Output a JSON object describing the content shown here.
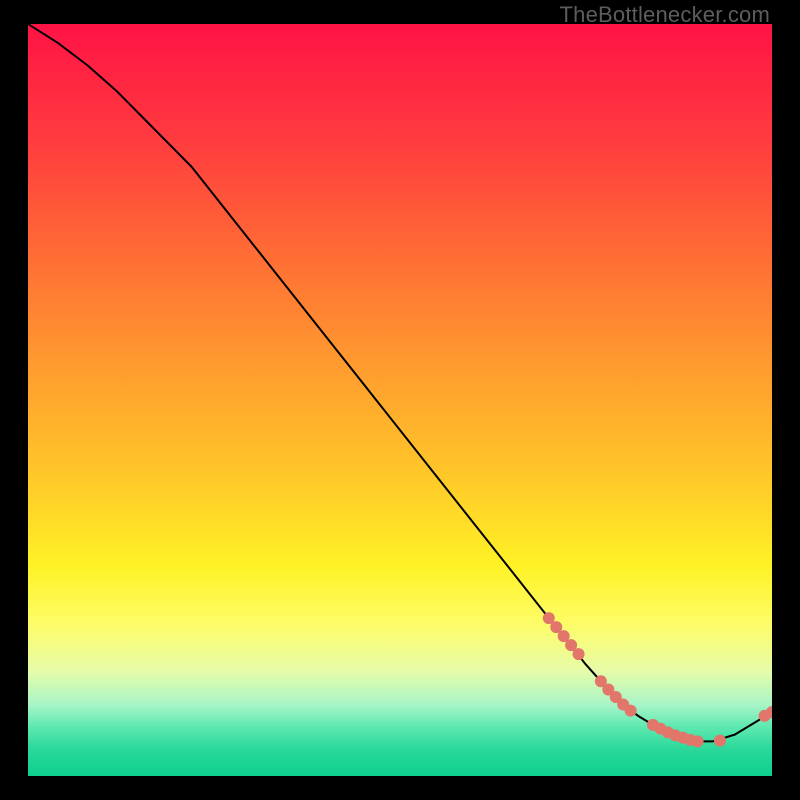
{
  "watermark": "TheBottlenecker.com",
  "gradient": {
    "stops": [
      {
        "offset": 0.0,
        "color": "#ff1345"
      },
      {
        "offset": 0.15,
        "color": "#ff3a3f"
      },
      {
        "offset": 0.3,
        "color": "#ff6a35"
      },
      {
        "offset": 0.45,
        "color": "#ff9a2f"
      },
      {
        "offset": 0.6,
        "color": "#ffc729"
      },
      {
        "offset": 0.72,
        "color": "#fff225"
      },
      {
        "offset": 0.8,
        "color": "#fdfd6a"
      },
      {
        "offset": 0.86,
        "color": "#e7fca8"
      },
      {
        "offset": 0.905,
        "color": "#a8f5c8"
      },
      {
        "offset": 0.935,
        "color": "#5de8b0"
      },
      {
        "offset": 0.965,
        "color": "#29d89a"
      },
      {
        "offset": 1.0,
        "color": "#0fd08f"
      }
    ]
  },
  "chart_data": {
    "type": "line",
    "title": "",
    "xlabel": "",
    "ylabel": "",
    "xlim": [
      0,
      100
    ],
    "ylim": [
      0,
      100
    ],
    "series": [
      {
        "name": "curve",
        "x": [
          0,
          4,
          8,
          12,
          16,
          22,
          30,
          40,
          50,
          60,
          70,
          75,
          78,
          80,
          82,
          84,
          86,
          88,
          90,
          92,
          95,
          100
        ],
        "y": [
          100,
          97.5,
          94.5,
          91,
          87,
          81,
          71,
          58.5,
          46,
          33.5,
          21,
          14.8,
          11.5,
          9.5,
          8,
          6.8,
          5.8,
          5.1,
          4.6,
          4.6,
          5.5,
          8.5
        ]
      }
    ],
    "scatter": {
      "name": "points",
      "color": "#e2766b",
      "x": [
        70,
        71,
        72,
        73,
        74,
        77,
        78,
        79,
        80,
        81,
        84,
        85,
        86,
        87,
        88,
        89,
        90,
        93,
        99,
        100
      ],
      "y": [
        21,
        19.8,
        18.6,
        17.4,
        16.2,
        12.6,
        11.5,
        10.5,
        9.5,
        8.7,
        6.8,
        6.3,
        5.8,
        5.4,
        5.1,
        4.8,
        4.6,
        4.7,
        8.0,
        8.5
      ]
    }
  }
}
